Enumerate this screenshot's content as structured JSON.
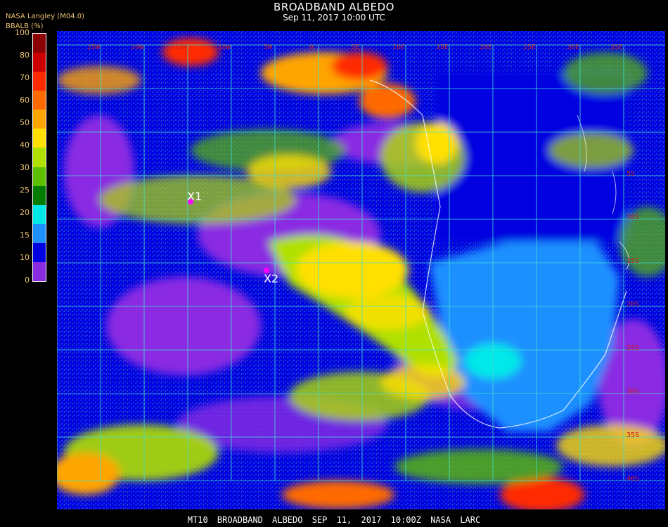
{
  "header": {
    "title": "BROADBAND ALBEDO",
    "subtitle": "Sep 11, 2017 10:00 UTC",
    "source": "NASA Langley (M04.0)"
  },
  "colorbar": {
    "label": "BBALB (%)",
    "ticks": [
      "100",
      "80",
      "70",
      "60",
      "50",
      "40",
      "30",
      "25",
      "20",
      "15",
      "10",
      "0"
    ],
    "colors": [
      "#8b0000",
      "#cc0000",
      "#ff2a00",
      "#ff6a00",
      "#ffa500",
      "#ffe000",
      "#b0e000",
      "#5cc000",
      "#007c00",
      "#00e8e8",
      "#1e90ff",
      "#0000e0",
      "#8a2be2"
    ]
  },
  "map": {
    "lon_labels": [
      "25W",
      "20W",
      "15W",
      "10W",
      "5W",
      "0",
      "5E",
      "10E",
      "15E",
      "20E",
      "25E",
      "30E",
      "35E"
    ],
    "lat_labels": [
      "5S",
      "10S",
      "15S",
      "20S",
      "25S",
      "30S",
      "35S",
      "40S"
    ],
    "markers": [
      {
        "label": "X1"
      },
      {
        "label": "X2"
      }
    ],
    "grid_color": "#40e0d0",
    "label_color": "#cc2222"
  },
  "footer": "MT10  BROADBAND ALBEDO   SEP 11, 2017 10:00Z   NASA LARC"
}
